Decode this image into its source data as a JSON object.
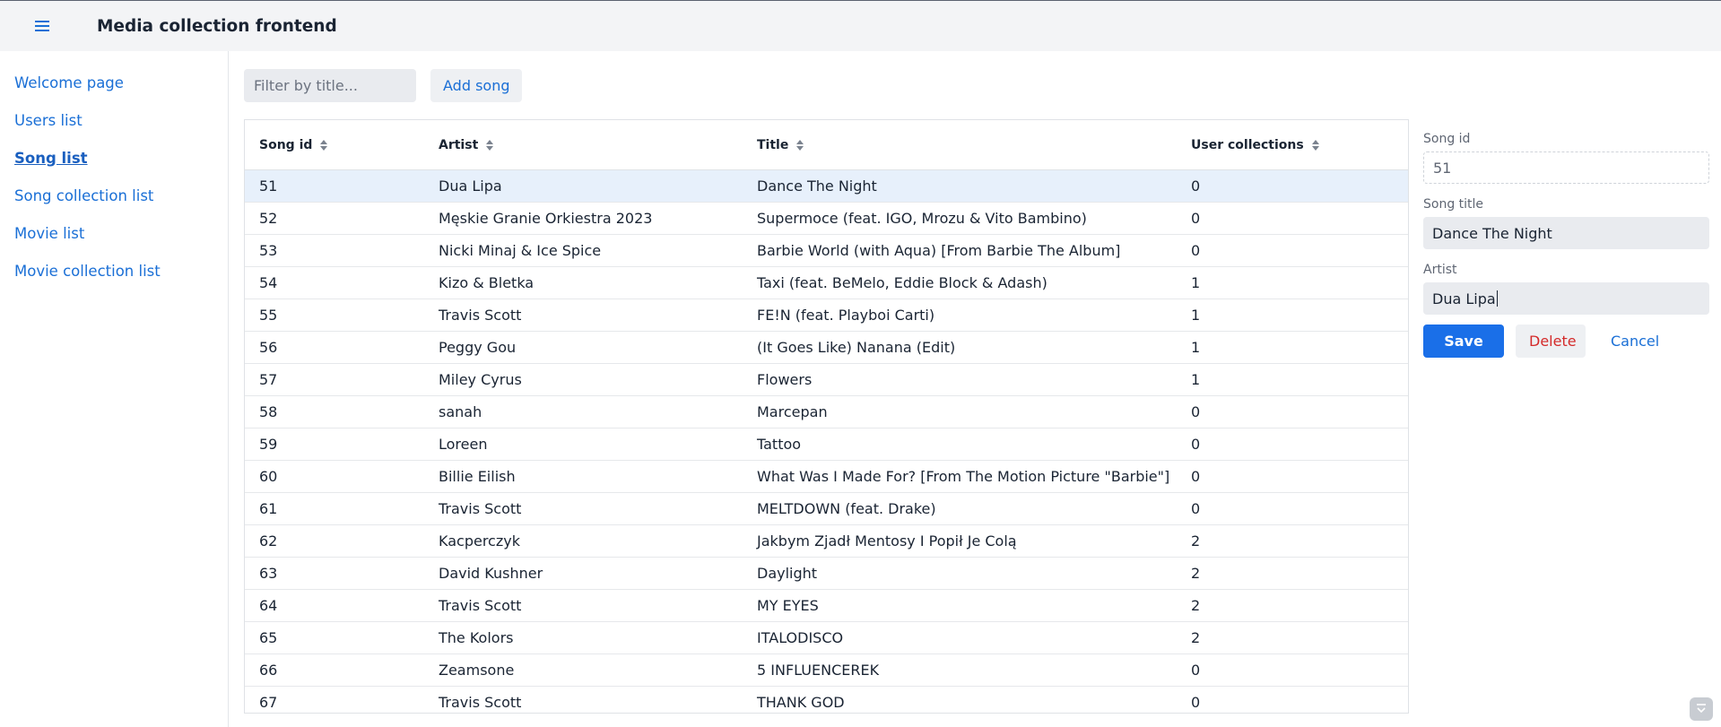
{
  "header": {
    "title": "Media collection frontend",
    "menu_icon": "menu-icon"
  },
  "sidebar": {
    "items": [
      {
        "label": "Welcome page",
        "active": false
      },
      {
        "label": "Users list",
        "active": false
      },
      {
        "label": "Song list",
        "active": true
      },
      {
        "label": "Song collection list",
        "active": false
      },
      {
        "label": "Movie list",
        "active": false
      },
      {
        "label": "Movie collection list",
        "active": false
      }
    ]
  },
  "toolbar": {
    "filter_placeholder": "Filter by title...",
    "filter_value": "",
    "add_label": "Add song"
  },
  "grid": {
    "columns": [
      "Song id",
      "Artist",
      "Title",
      "User collections"
    ],
    "selected_id": "51",
    "rows": [
      {
        "id": "51",
        "artist": "Dua Lipa",
        "title": "Dance The Night",
        "collections": "0"
      },
      {
        "id": "52",
        "artist": "Męskie Granie Orkiestra 2023",
        "title": "Supermoce (feat. IGO, Mrozu & Vito Bambino)",
        "collections": "0"
      },
      {
        "id": "53",
        "artist": "Nicki Minaj & Ice Spice",
        "title": "Barbie World (with Aqua) [From Barbie The Album]",
        "collections": "0"
      },
      {
        "id": "54",
        "artist": "Kizo & Bletka",
        "title": "Taxi (feat. BeMelo, Eddie Block & Adash)",
        "collections": "1"
      },
      {
        "id": "55",
        "artist": "Travis Scott",
        "title": "FE!N (feat. Playboi Carti)",
        "collections": "1"
      },
      {
        "id": "56",
        "artist": "Peggy Gou",
        "title": "(It Goes Like) Nanana (Edit)",
        "collections": "1"
      },
      {
        "id": "57",
        "artist": "Miley Cyrus",
        "title": "Flowers",
        "collections": "1"
      },
      {
        "id": "58",
        "artist": "sanah",
        "title": "Marcepan",
        "collections": "0"
      },
      {
        "id": "59",
        "artist": "Loreen",
        "title": "Tattoo",
        "collections": "0"
      },
      {
        "id": "60",
        "artist": "Billie Eilish",
        "title": "What Was I Made For? [From The Motion Picture \"Barbie\"]",
        "collections": "0"
      },
      {
        "id": "61",
        "artist": "Travis Scott",
        "title": "MELTDOWN (feat. Drake)",
        "collections": "0"
      },
      {
        "id": "62",
        "artist": "Kacperczyk",
        "title": "Jakbym Zjadł Mentosy I Popił Je Colą",
        "collections": "2"
      },
      {
        "id": "63",
        "artist": "David Kushner",
        "title": "Daylight",
        "collections": "2"
      },
      {
        "id": "64",
        "artist": "Travis Scott",
        "title": "MY EYES",
        "collections": "2"
      },
      {
        "id": "65",
        "artist": "The Kolors",
        "title": "ITALODISCO",
        "collections": "2"
      },
      {
        "id": "66",
        "artist": "Zeamsone",
        "title": "5 INFLUENCEREK",
        "collections": "0"
      },
      {
        "id": "67",
        "artist": "Travis Scott",
        "title": "THANK GOD",
        "collections": "0"
      }
    ]
  },
  "form": {
    "song_id_label": "Song id",
    "song_id_value": "51",
    "title_label": "Song title",
    "title_value": "Dance The Night",
    "artist_label": "Artist",
    "artist_value": "Dua Lipa",
    "save_label": "Save",
    "delete_label": "Delete",
    "cancel_label": "Cancel"
  },
  "colors": {
    "accent": "#1a6fe8",
    "link": "#1a6fd6",
    "danger": "#d42a2a",
    "selected_row": "#e7f0fb"
  }
}
